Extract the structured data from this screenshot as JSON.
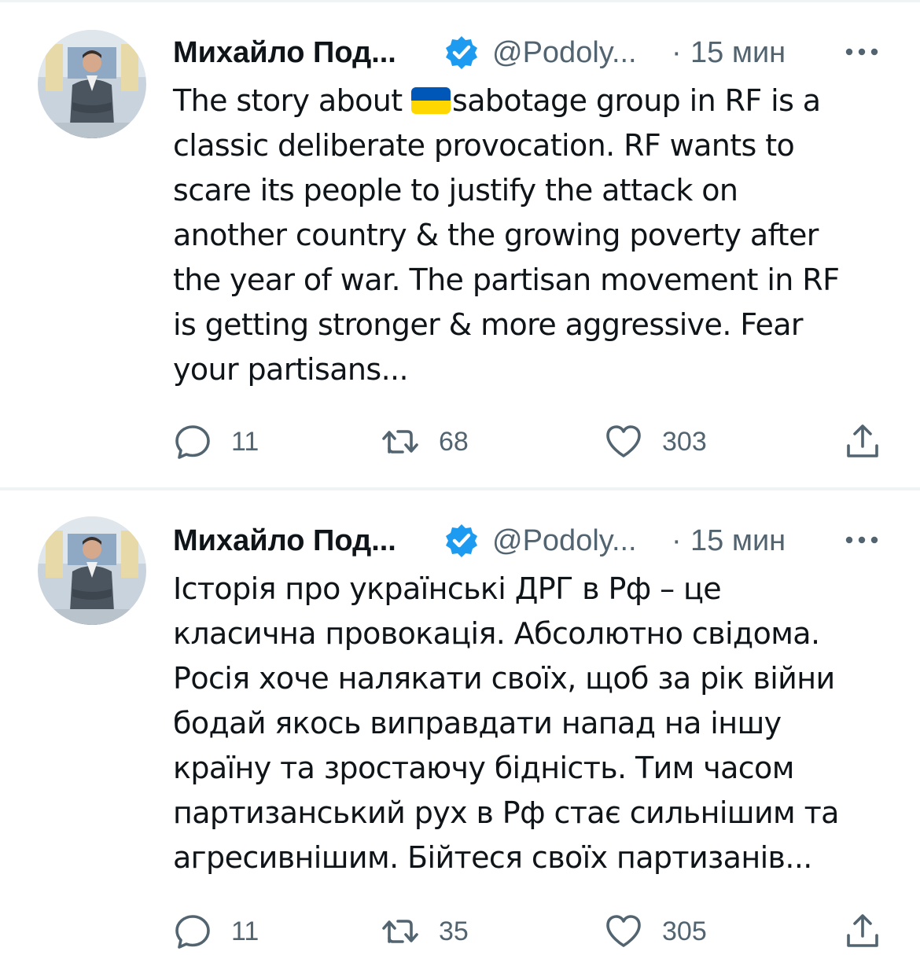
{
  "tweets": [
    {
      "author_name": "Михайло Под...",
      "handle": "@Podoly...",
      "separator": "·",
      "time": "15 мин",
      "text_before_flag": "The story about ",
      "flag": "ukraine-flag-emoji",
      "text_after_flag": "sabotage group in RF is a\nclassic deliberate provocation. RF wants to\nscare its people to justify the attack on\nanother country & the growing poverty after\nthe year of war. The partisan movement in RF\nis getting stronger & more aggressive. Fear\nyour partisans...",
      "replies": "11",
      "retweets": "68",
      "likes": "303"
    },
    {
      "author_name": "Михайло Под...",
      "handle": "@Podoly...",
      "separator": "·",
      "time": "15 мин",
      "text": "Історія про українські ДРГ в Рф – це\nкласична провокація. Абсолютно свідома.\nРосія хоче налякати своїх, щоб за рік війни\nбодай якось виправдати напад на іншу\nкраїну та зростаючу бідність. Тим часом\nпартизанський рух в Рф стає сильнішим та\nагресивнішим. Бійтеся своїх партизанів...",
      "replies": "11",
      "retweets": "35",
      "likes": "305"
    }
  ],
  "icons": {
    "verified": "verified-badge-icon",
    "more": "more-dots-icon",
    "reply": "reply-icon",
    "retweet": "retweet-icon",
    "like": "heart-icon",
    "share": "share-icon"
  },
  "colors": {
    "verified_blue": "#1d9bf0",
    "text_primary": "#0f1419",
    "text_secondary": "#536471",
    "divider": "#eff3f4",
    "flag_blue": "#0057b7",
    "flag_yellow": "#ffd700"
  }
}
